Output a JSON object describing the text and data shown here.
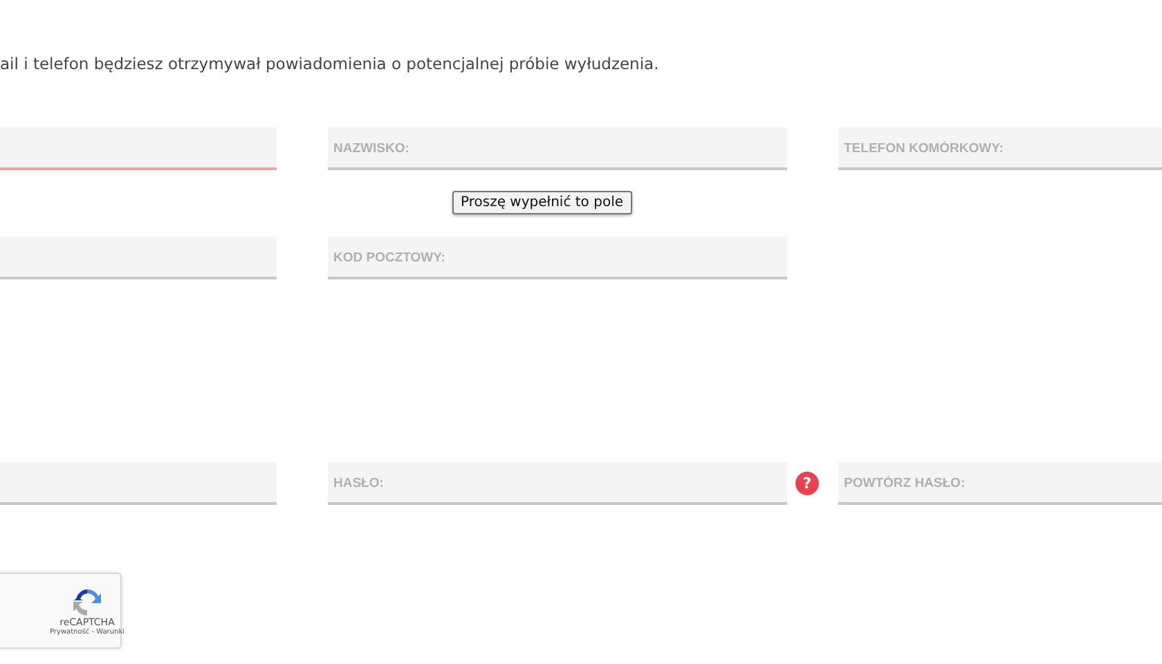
{
  "intro": "ail i telefon będziesz otrzymywał powiadomienia o potencjalnej próbie wyłudzenia.",
  "rows": [
    [
      {
        "invalid": true
      },
      {
        "placeholder": "NAZWISKO:",
        "invalid": false
      },
      {
        "placeholder": "TELEFON KOMÓRKOWY:",
        "invalid": false
      }
    ],
    [
      {
        "invalid": false
      },
      {
        "placeholder": "KOD POCZTOWY:",
        "invalid": false
      }
    ],
    [
      {
        "invalid": false
      },
      {
        "placeholder": "HASŁO:",
        "invalid": false,
        "help": "?"
      },
      {
        "placeholder": "POWTÓRZ HASŁO:",
        "invalid": false
      }
    ]
  ],
  "validation_tooltip": "Proszę wypełnić to pole",
  "captcha": {
    "title": "reCAPTCHA",
    "links": "Prywatność - Warunki"
  }
}
